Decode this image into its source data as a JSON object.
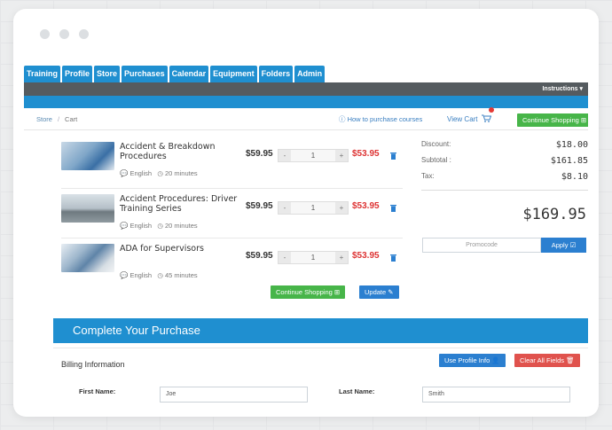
{
  "nav": {
    "tabs": [
      "Training",
      "Profile",
      "Store",
      "Purchases",
      "Calendar",
      "Equipment",
      "Folders",
      "Admin"
    ],
    "instructions": "Instructions"
  },
  "breadcrumb": {
    "store": "Store",
    "current": "Cart"
  },
  "links": {
    "howto": "How to purchase courses",
    "view_cart": "View Cart"
  },
  "buttons": {
    "continue_shopping": "Continue Shopping",
    "update": "Update",
    "apply": "Apply",
    "use_profile": "Use Profile Info",
    "clear_fields": "Clear All Fields"
  },
  "cart": [
    {
      "title": "Accident & Breakdown Procedures",
      "language": "English",
      "duration": "20 minutes",
      "price": "$59.95",
      "qty": "1",
      "total": "$53.95"
    },
    {
      "title": "Accident Procedures: Driver Training Series",
      "language": "English",
      "duration": "20 minutes",
      "price": "$59.95",
      "qty": "1",
      "total": "$53.95"
    },
    {
      "title": "ADA for Supervisors",
      "language": "English",
      "duration": "45 minutes",
      "price": "$59.95",
      "qty": "1",
      "total": "$53.95"
    }
  ],
  "summary": {
    "discount_label": "Discount:",
    "discount": "$18.00",
    "subtotal_label": "Subtotal :",
    "subtotal": "$161.85",
    "tax_label": "Tax:",
    "tax": "$8.10",
    "total": "$169.95",
    "promo_placeholder": "Promocode"
  },
  "purchase": {
    "heading": "Complete Your Purchase",
    "billing_heading": "Billing Information",
    "first_name_label": "First Name:",
    "first_name": "Joe",
    "last_name_label": "Last Name:",
    "last_name": "Smith"
  },
  "colors": {
    "primary": "#1f8fd0",
    "green": "#47b549",
    "red": "#e0524d",
    "dark": "#555b5f"
  }
}
